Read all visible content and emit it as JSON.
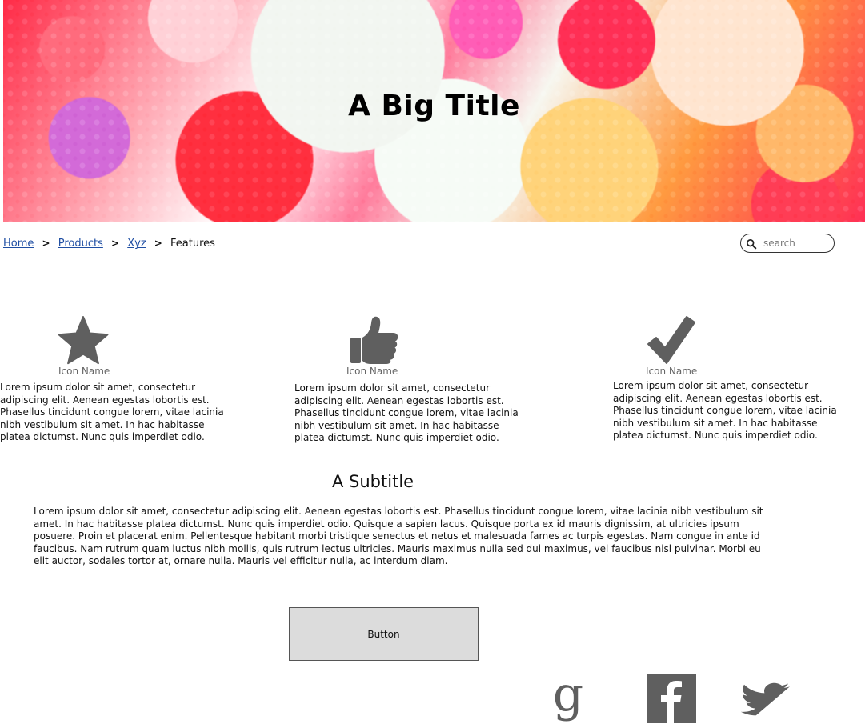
{
  "hero": {
    "title": "A Big Title"
  },
  "breadcrumb": {
    "items": [
      {
        "label": "Home",
        "link": true
      },
      {
        "label": "Products",
        "link": true
      },
      {
        "label": "Xyz",
        "link": true
      },
      {
        "label": "Features",
        "link": false
      }
    ],
    "separator": ">"
  },
  "search": {
    "placeholder": "search",
    "icon": "search-icon"
  },
  "features": [
    {
      "icon": "star-icon",
      "name": "Icon Name",
      "text": "Lorem ipsum dolor sit amet, consectetur adipiscing elit. Aenean egestas lobortis est. Phasellus tincidunt congue lorem, vitae lacinia nibh vestibulum sit amet. In hac habitasse platea dictumst. Nunc quis imperdiet odio."
    },
    {
      "icon": "thumbs-up-icon",
      "name": "Icon Name",
      "text": "Lorem ipsum dolor sit amet, consectetur adipiscing elit. Aenean egestas lobortis est. Phasellus tincidunt congue lorem, vitae lacinia nibh vestibulum sit amet. In hac habitasse platea dictumst. Nunc quis imperdiet odio."
    },
    {
      "icon": "checkmark-icon",
      "name": "Icon Name",
      "text": "Lorem ipsum dolor sit amet, consectetur adipiscing elit. Aenean egestas lobortis est. Phasellus tincidunt congue lorem, vitae lacinia nibh vestibulum sit amet. In hac habitasse platea dictumst. Nunc quis imperdiet odio."
    }
  ],
  "section": {
    "subtitle": "A Subtitle",
    "paragraph": "Lorem ipsum dolor sit amet, consectetur adipiscing elit. Aenean egestas lobortis est. Phasellus tincidunt congue lorem, vitae lacinia nibh vestibulum sit amet. In hac habitasse platea dictumst. Nunc quis imperdiet odio. Quisque a sapien lacus. Quisque porta ex id mauris dignissim, at ultricies ipsum posuere. Proin et placerat enim. Pellentesque habitant morbi tristique senectus et netus et malesuada fames ac turpis egestas. Nam congue in ante id faucibus. Nam rutrum quam luctus nibh mollis, quis rutrum lectus ultricies. Mauris maximus nulla sed dui maximus, vel faucibus nisl pulvinar. Morbi eu elit auctor, sodales tortor at, ornare nulla. Mauris vel efficitur nulla, ac interdum diam."
  },
  "button": {
    "label": "Button"
  },
  "social": [
    {
      "icon": "google-icon"
    },
    {
      "icon": "facebook-icon"
    },
    {
      "icon": "twitter-icon"
    }
  ],
  "colors": {
    "link": "#1f4ea3",
    "icon": "#5f5f5f",
    "button_bg": "#dcdcdc"
  }
}
